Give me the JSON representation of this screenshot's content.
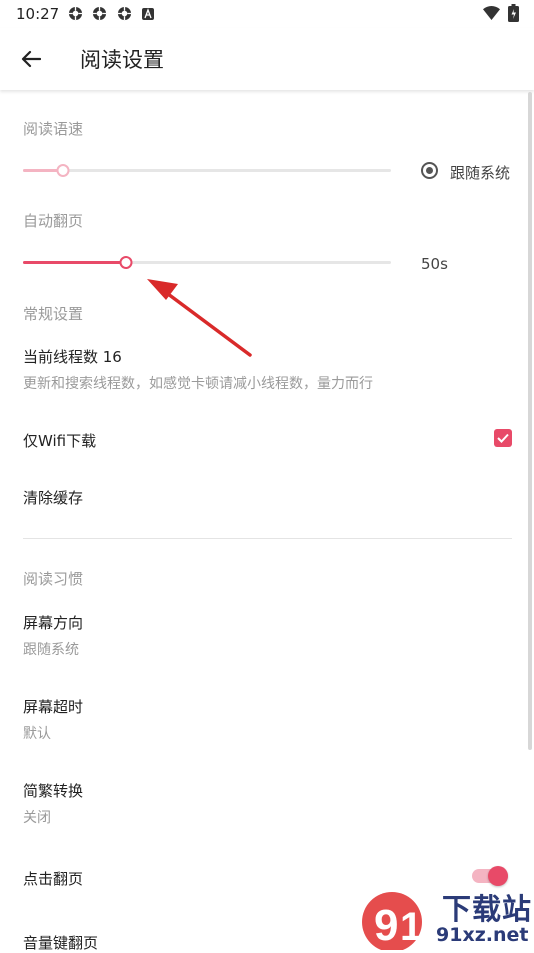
{
  "status_bar": {
    "time": "10:27",
    "icons": [
      "gear-icon",
      "gear-icon",
      "gear-icon",
      "font-icon"
    ],
    "right_icons": [
      "wifi-icon",
      "battery-icon"
    ]
  },
  "app_bar": {
    "back_icon": "arrow-left-icon",
    "title": "阅读设置"
  },
  "reading_speed": {
    "section": "阅读语速",
    "slider_value": 0.11,
    "follow_system_label": "跟随系统",
    "follow_system_checked": true
  },
  "auto_page": {
    "section": "自动翻页",
    "slider_value": 0.28,
    "value_label": "50s"
  },
  "general": {
    "section": "常规设置",
    "threads_title": "当前线程数 16",
    "threads_sub": "更新和搜索线程数，如感觉卡顿请减小线程数，量力而行",
    "wifi_title": "仅Wifi下载",
    "wifi_checked": true,
    "clear_cache": "清除缓存"
  },
  "habits": {
    "section": "阅读习惯",
    "orientation_title": "屏幕方向",
    "orientation_value": "跟随系统",
    "timeout_title": "屏幕超时",
    "timeout_value": "默认",
    "conversion_title": "简繁转换",
    "conversion_value": "关闭",
    "tap_page_title": "点击翻页",
    "tap_page_on": true,
    "volume_key_title": "音量键翻页"
  },
  "watermark": {
    "site_name": "下载站",
    "url": "91xz.net"
  },
  "colors": {
    "accent": "#e84a68",
    "accent_light": "#f4b4c2",
    "annotation_arrow": "#d92a2a"
  }
}
